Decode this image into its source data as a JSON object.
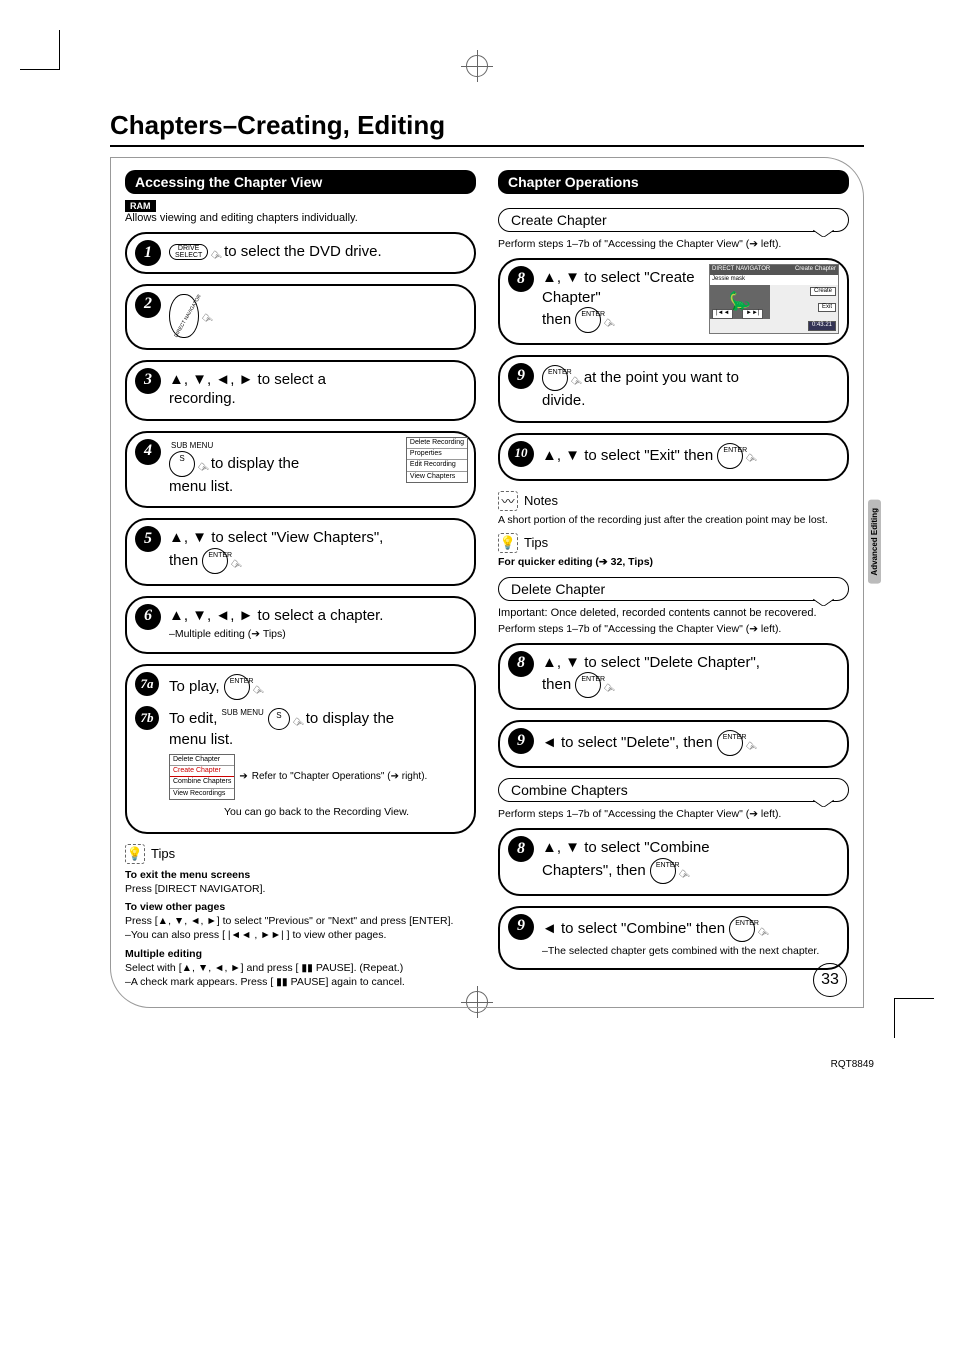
{
  "page": {
    "title": "Chapters–Creating, Editing",
    "number": "33",
    "footer_code": "RQT8849",
    "side_tab": "Advanced Editing"
  },
  "left": {
    "header": "Accessing the Chapter View",
    "ram_label": "RAM",
    "intro": "Allows viewing and editing chapters individually.",
    "steps": {
      "s1": {
        "btn": "DRIVE SELECT",
        "text": " to select the DVD drive."
      },
      "s2": {
        "btn": "DIRECT NAVIGATOR"
      },
      "s3": {
        "text_a": "▲, ▼, ◄, ► to select a",
        "text_b": "recording."
      },
      "s4": {
        "btn_top": "SUB MENU",
        "btn_round": "S",
        "text_a": " to display the",
        "text_b": "menu list.",
        "menu": [
          "Delete Recording",
          "Properties",
          "Edit Recording",
          "View Chapters"
        ]
      },
      "s5": {
        "text_a": "▲, ▼ to select \"View Chapters\",",
        "text_b": "then ",
        "enter": "ENTER"
      },
      "s6": {
        "text_a": "▲, ▼, ◄, ► to select a chapter.",
        "sub": "–Multiple editing (➔ Tips)"
      },
      "s7a": {
        "label": "7a",
        "text": "To play, ",
        "enter": "ENTER"
      },
      "s7b": {
        "label": "7b",
        "text_a": "To edit, ",
        "btn_top": "SUB MENU",
        "btn_round": "S",
        "text_b": " to display the",
        "text_c": "menu list.",
        "menu": [
          "Delete Chapter",
          "Create Chapter",
          "Combine Chapters",
          "View Recordings"
        ],
        "ref": "Refer to \"Chapter Operations\" (➔ right).",
        "back_note": "You can go back to the Recording View."
      }
    },
    "tips": {
      "title": "Tips",
      "exit_h": "To exit the menu screens",
      "exit_t": "Press [DIRECT NAVIGATOR].",
      "pages_h": "To view other pages",
      "pages_t1": "Press [▲, ▼, ◄, ►] to select \"Previous\" or \"Next\" and press [ENTER].",
      "pages_t2": "–You can also press [ |◄◄ , ►►| ] to view other pages.",
      "multi_h": "Multiple editing",
      "multi_t1": "Select with [▲, ▼, ◄, ►] and press [ ▮▮ PAUSE]. (Repeat.)",
      "multi_t2": "–A check mark appears. Press [ ▮▮ PAUSE] again to cancel."
    }
  },
  "right": {
    "header": "Chapter Operations",
    "create": {
      "pill": "Create Chapter",
      "lead": "Perform steps 1–7b of \"Accessing the Chapter View\" (➔ left).",
      "s8a": "▲, ▼ to select \"Create Chapter\"",
      "s8b": "then ",
      "enter": "ENTER",
      "shot": {
        "hdr_l": "DIRECT NAVIGATOR",
        "hdr_r": "Create Chapter",
        "sub": "Jessie mask",
        "btns": {
          "prev": "|◄◄",
          "next": "►►|",
          "create": "Create",
          "exit": "Exit"
        },
        "time": "0:43.21"
      },
      "s9a": " at the point you want to",
      "s9b": "divide.",
      "s10": "▲, ▼ to select \"Exit\" then ",
      "notes_h": "Notes",
      "notes_t": "A short portion of the recording just after the creation point may be lost.",
      "tips_h": "Tips",
      "tips_t": "For quicker editing (➔ 32, Tips)"
    },
    "delete": {
      "pill": "Delete Chapter",
      "important": "Important: Once deleted, recorded contents cannot be recovered.",
      "lead": "Perform steps 1–7b of \"Accessing the Chapter View\" (➔ left).",
      "s8a": "▲, ▼ to select \"Delete Chapter\",",
      "s8b": "then ",
      "s9": "◄ to select \"Delete\", then "
    },
    "combine": {
      "pill": "Combine Chapters",
      "lead": "Perform steps 1–7b of \"Accessing the Chapter View\" (➔ left).",
      "s8a": "▲, ▼ to select \"Combine",
      "s8b": "Chapters\", then ",
      "s9": "◄ to select \"Combine\" then ",
      "s9sub": "–The selected chapter gets combined with the next chapter."
    }
  }
}
